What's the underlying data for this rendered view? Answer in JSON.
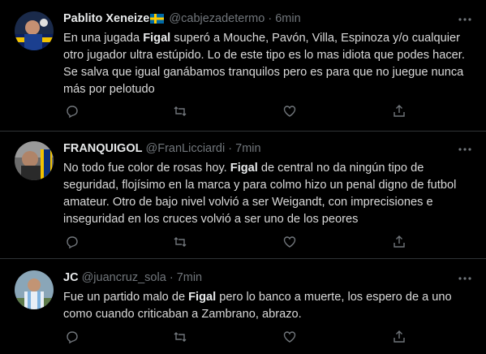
{
  "tweets": [
    {
      "name": "Pablito Xeneize",
      "handle": "@cabjezadetermo",
      "separator": "·",
      "time": "6min",
      "body": [
        {
          "t": "En una jugada ",
          "b": false
        },
        {
          "t": "Figal",
          "b": true
        },
        {
          "t": " superó a Mouche, Pavón, Villa, Espinoza y/o cualquier otro jugador ultra estúpido. Lo de este tipo es lo mas idiota que podes hacer. Se salva que igual ganábamos tranquilos pero es para que no juegue nunca más por pelotudo",
          "b": false
        }
      ],
      "flag": "sweden-flag-icon"
    },
    {
      "name": "FRANQUIGOL",
      "handle": "@FranLicciardi",
      "separator": "·",
      "time": "7min",
      "body": [
        {
          "t": "No todo fue color de rosas hoy. ",
          "b": false
        },
        {
          "t": "Figal",
          "b": true
        },
        {
          "t": " de central no da ningún tipo de seguridad, flojísimo en la marca y para colmo hizo un penal digno de futbol amateur. Otro de bajo nivel volvió a ser Weigandt, con imprecisiones e inseguridad en los cruces volvió a ser uno de los peores",
          "b": false
        }
      ]
    },
    {
      "name": "JC",
      "handle": "@juancruz_sola",
      "separator": "·",
      "time": "7min",
      "body": [
        {
          "t": "Fue un partido malo de ",
          "b": false
        },
        {
          "t": "Figal",
          "b": true
        },
        {
          "t": " pero lo banco a muerte, los espero de a uno como cuando criticaban a Zambrano, abrazo.",
          "b": false
        }
      ]
    }
  ],
  "icons": {
    "more": "more-icon",
    "reply": "reply-icon",
    "retweet": "retweet-icon",
    "like": "like-icon",
    "share": "share-icon"
  },
  "colors": {
    "background": "#000000",
    "text": "#d9d9d9",
    "muted": "#71767b",
    "divider": "#2f3336",
    "flag_blue": "#006aa7",
    "flag_yellow": "#fecc00"
  }
}
